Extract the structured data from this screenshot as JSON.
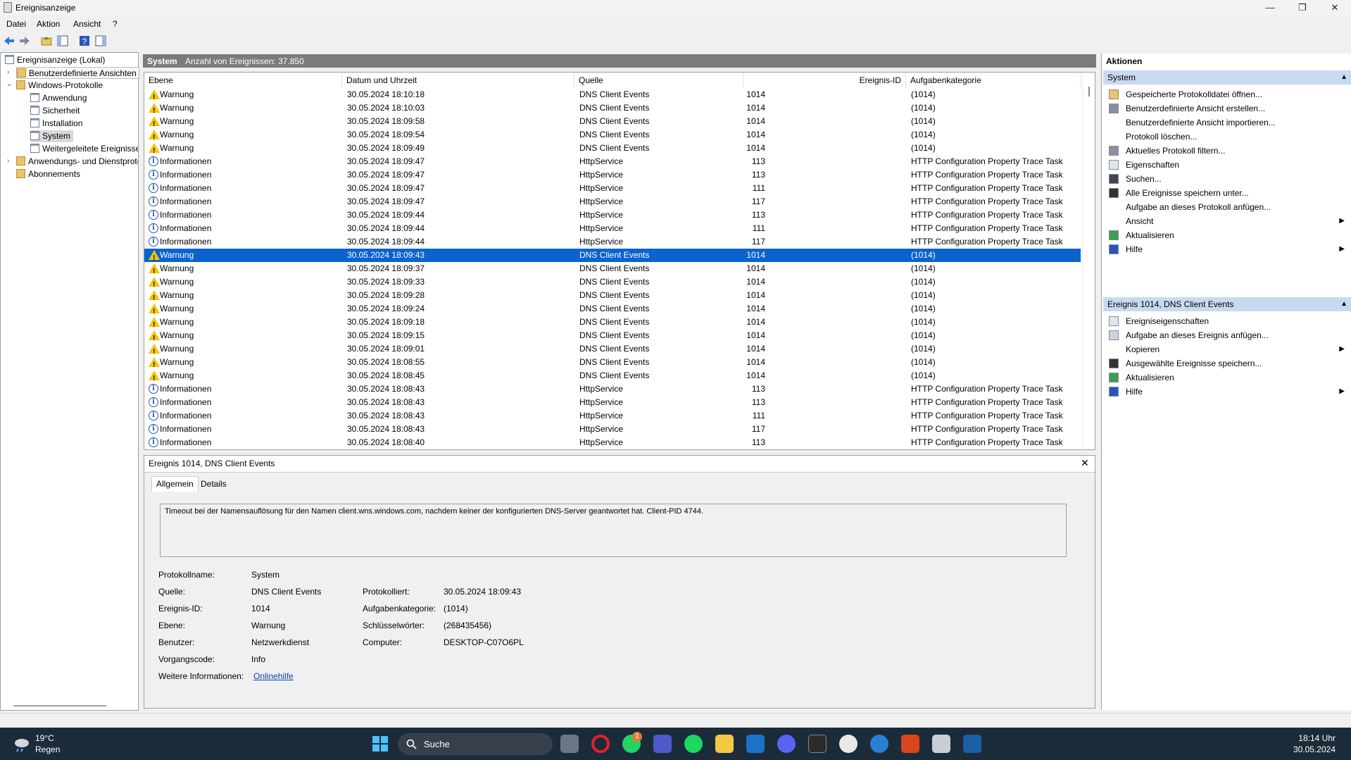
{
  "window": {
    "title": "Ereignisanzeige",
    "min": "—",
    "max": "❐",
    "close": "✕"
  },
  "menu": [
    "Datei",
    "Aktion",
    "Ansicht",
    "?"
  ],
  "tree": {
    "root": "Ereignisanzeige (Lokal)",
    "custom_views": "Benutzerdefinierte Ansichten",
    "windows_logs": "Windows-Protokolle",
    "logs": [
      "Anwendung",
      "Sicherheit",
      "Installation",
      "System",
      "Weitergeleitete Ereignisse"
    ],
    "app_service_logs": "Anwendungs- und Dienstprotokolle",
    "subscriptions": "Abonnements"
  },
  "center": {
    "log_name": "System",
    "count_label": "Anzahl von Ereignissen: 37.850"
  },
  "columns": [
    "Ebene",
    "Datum und Uhrzeit",
    "Quelle",
    "Ereignis-ID",
    "Aufgabenkategorie"
  ],
  "events": [
    {
      "level": "Warnung",
      "type": "warn",
      "date": "30.05.2024 18:10:18",
      "source": "DNS Client Events",
      "id": "1014",
      "cat": "(1014)"
    },
    {
      "level": "Warnung",
      "type": "warn",
      "date": "30.05.2024 18:10:03",
      "source": "DNS Client Events",
      "id": "1014",
      "cat": "(1014)"
    },
    {
      "level": "Warnung",
      "type": "warn",
      "date": "30.05.2024 18:09:58",
      "source": "DNS Client Events",
      "id": "1014",
      "cat": "(1014)"
    },
    {
      "level": "Warnung",
      "type": "warn",
      "date": "30.05.2024 18:09:54",
      "source": "DNS Client Events",
      "id": "1014",
      "cat": "(1014)"
    },
    {
      "level": "Warnung",
      "type": "warn",
      "date": "30.05.2024 18:09:49",
      "source": "DNS Client Events",
      "id": "1014",
      "cat": "(1014)"
    },
    {
      "level": "Informationen",
      "type": "info",
      "date": "30.05.2024 18:09:47",
      "source": "HttpService",
      "id": "113",
      "cat": "HTTP Configuration Property Trace Task"
    },
    {
      "level": "Informationen",
      "type": "info",
      "date": "30.05.2024 18:09:47",
      "source": "HttpService",
      "id": "113",
      "cat": "HTTP Configuration Property Trace Task"
    },
    {
      "level": "Informationen",
      "type": "info",
      "date": "30.05.2024 18:09:47",
      "source": "HttpService",
      "id": "111",
      "cat": "HTTP Configuration Property Trace Task"
    },
    {
      "level": "Informationen",
      "type": "info",
      "date": "30.05.2024 18:09:47",
      "source": "HttpService",
      "id": "117",
      "cat": "HTTP Configuration Property Trace Task"
    },
    {
      "level": "Informationen",
      "type": "info",
      "date": "30.05.2024 18:09:44",
      "source": "HttpService",
      "id": "113",
      "cat": "HTTP Configuration Property Trace Task"
    },
    {
      "level": "Informationen",
      "type": "info",
      "date": "30.05.2024 18:09:44",
      "source": "HttpService",
      "id": "111",
      "cat": "HTTP Configuration Property Trace Task"
    },
    {
      "level": "Informationen",
      "type": "info",
      "date": "30.05.2024 18:09:44",
      "source": "HttpService",
      "id": "117",
      "cat": "HTTP Configuration Property Trace Task"
    },
    {
      "level": "Warnung",
      "type": "warn",
      "date": "30.05.2024 18:09:43",
      "source": "DNS Client Events",
      "id": "1014",
      "cat": "(1014)",
      "selected": true
    },
    {
      "level": "Warnung",
      "type": "warn",
      "date": "30.05.2024 18:09:37",
      "source": "DNS Client Events",
      "id": "1014",
      "cat": "(1014)"
    },
    {
      "level": "Warnung",
      "type": "warn",
      "date": "30.05.2024 18:09:33",
      "source": "DNS Client Events",
      "id": "1014",
      "cat": "(1014)"
    },
    {
      "level": "Warnung",
      "type": "warn",
      "date": "30.05.2024 18:09:28",
      "source": "DNS Client Events",
      "id": "1014",
      "cat": "(1014)"
    },
    {
      "level": "Warnung",
      "type": "warn",
      "date": "30.05.2024 18:09:24",
      "source": "DNS Client Events",
      "id": "1014",
      "cat": "(1014)"
    },
    {
      "level": "Warnung",
      "type": "warn",
      "date": "30.05.2024 18:09:18",
      "source": "DNS Client Events",
      "id": "1014",
      "cat": "(1014)"
    },
    {
      "level": "Warnung",
      "type": "warn",
      "date": "30.05.2024 18:09:15",
      "source": "DNS Client Events",
      "id": "1014",
      "cat": "(1014)"
    },
    {
      "level": "Warnung",
      "type": "warn",
      "date": "30.05.2024 18:09:01",
      "source": "DNS Client Events",
      "id": "1014",
      "cat": "(1014)"
    },
    {
      "level": "Warnung",
      "type": "warn",
      "date": "30.05.2024 18:08:55",
      "source": "DNS Client Events",
      "id": "1014",
      "cat": "(1014)"
    },
    {
      "level": "Warnung",
      "type": "warn",
      "date": "30.05.2024 18:08:45",
      "source": "DNS Client Events",
      "id": "1014",
      "cat": "(1014)"
    },
    {
      "level": "Informationen",
      "type": "info",
      "date": "30.05.2024 18:08:43",
      "source": "HttpService",
      "id": "113",
      "cat": "HTTP Configuration Property Trace Task"
    },
    {
      "level": "Informationen",
      "type": "info",
      "date": "30.05.2024 18:08:43",
      "source": "HttpService",
      "id": "113",
      "cat": "HTTP Configuration Property Trace Task"
    },
    {
      "level": "Informationen",
      "type": "info",
      "date": "30.05.2024 18:08:43",
      "source": "HttpService",
      "id": "111",
      "cat": "HTTP Configuration Property Trace Task"
    },
    {
      "level": "Informationen",
      "type": "info",
      "date": "30.05.2024 18:08:43",
      "source": "HttpService",
      "id": "117",
      "cat": "HTTP Configuration Property Trace Task"
    },
    {
      "level": "Informationen",
      "type": "info",
      "date": "30.05.2024 18:08:40",
      "source": "HttpService",
      "id": "113",
      "cat": "HTTP Configuration Property Trace Task"
    }
  ],
  "detail": {
    "title": "Ereignis 1014, DNS Client Events",
    "tabs": [
      "Allgemein",
      "Details"
    ],
    "message": "Timeout bei der Namensauflösung für den Namen client.wns.windows.com, nachdem keiner der konfigurierten DNS-Server geantwortet hat. Client-PID 4744.",
    "fields": {
      "logname_label": "Protokollname:",
      "logname": "System",
      "source_label": "Quelle:",
      "source": "DNS Client Events",
      "logged_label": "Protokolliert:",
      "logged": "30.05.2024 18:09:43",
      "eventid_label": "Ereignis-ID:",
      "eventid": "1014",
      "taskcat_label": "Aufgabenkategorie:",
      "taskcat": "(1014)",
      "level_label": "Ebene:",
      "level": "Warnung",
      "keywords_label": "Schlüsselwörter:",
      "keywords": "(268435456)",
      "user_label": "Benutzer:",
      "user": "Netzwerkdienst",
      "computer_label": "Computer:",
      "computer": "DESKTOP-C07O6PL",
      "opcode_label": "Vorgangscode:",
      "opcode": "Info",
      "moreinfo_label": "Weitere Informationen:",
      "moreinfo": "Onlinehilfe"
    }
  },
  "actions": {
    "title": "Aktionen",
    "section1": "System",
    "items1": [
      {
        "label": "Gespeicherte Protokolldatei öffnen...",
        "icon": "open-folder-icon"
      },
      {
        "label": "Benutzerdefinierte Ansicht erstellen...",
        "icon": "filter-icon"
      },
      {
        "label": "Benutzerdefinierte Ansicht importieren...",
        "icon": ""
      },
      {
        "label": "Protokoll löschen...",
        "icon": ""
      },
      {
        "label": "Aktuelles Protokoll filtern...",
        "icon": "filter-icon"
      },
      {
        "label": "Eigenschaften",
        "icon": "properties-icon"
      },
      {
        "label": "Suchen...",
        "icon": "binoculars-icon"
      },
      {
        "label": "Alle Ereignisse speichern unter...",
        "icon": "save-icon"
      },
      {
        "label": "Aufgabe an dieses Protokoll anfügen...",
        "icon": ""
      },
      {
        "label": "Ansicht",
        "icon": "",
        "sub": true
      },
      {
        "label": "Aktualisieren",
        "icon": "refresh-icon"
      },
      {
        "label": "Hilfe",
        "icon": "help-icon",
        "sub": true
      }
    ],
    "section2": "Ereignis 1014, DNS Client Events",
    "items2": [
      {
        "label": "Ereigniseigenschaften",
        "icon": "properties-icon"
      },
      {
        "label": "Aufgabe an dieses Ereignis anfügen...",
        "icon": "task-icon"
      },
      {
        "label": "Kopieren",
        "icon": "",
        "sub": true
      },
      {
        "label": "Ausgewählte Ereignisse speichern...",
        "icon": "save-icon"
      },
      {
        "label": "Aktualisieren",
        "icon": "refresh-icon"
      },
      {
        "label": "Hilfe",
        "icon": "help-icon",
        "sub": true
      }
    ]
  },
  "taskbar": {
    "weather_temp": "19°C",
    "weather_desc": "Regen",
    "search": "Suche",
    "time": "18:14 Uhr",
    "date": "30.05.2024",
    "badge": "1"
  },
  "colors": {
    "selection": "#0b63ce",
    "section_header": "#c9daf0",
    "taskbar": "#1c2b3a"
  }
}
